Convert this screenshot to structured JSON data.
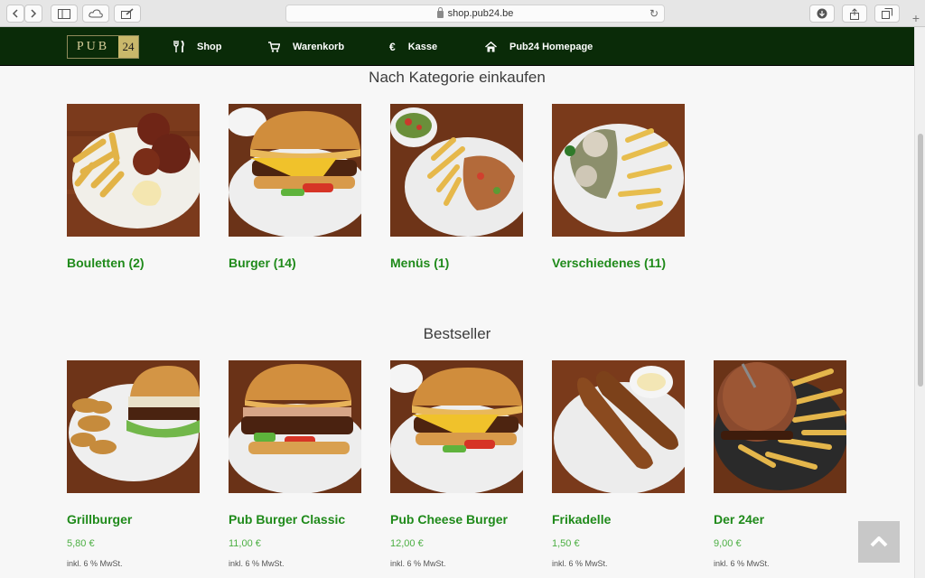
{
  "browser": {
    "url": "shop.pub24.be"
  },
  "nav": {
    "logo_word": "PUB",
    "logo_number": "24",
    "items": [
      {
        "label": "Shop",
        "icon": "cutlery-icon"
      },
      {
        "label": "Warenkorb",
        "icon": "cart-icon"
      },
      {
        "label": "Kasse",
        "icon": "euro-icon"
      },
      {
        "label": "Pub24 Homepage",
        "icon": "home-icon"
      }
    ]
  },
  "categories": {
    "title": "Nach Kategorie einkaufen",
    "items": [
      {
        "label": "Bouletten (2)"
      },
      {
        "label": "Burger (14)"
      },
      {
        "label": "Menüs (1)"
      },
      {
        "label": "Verschiedenes (11)"
      }
    ]
  },
  "bestseller": {
    "title": "Bestseller",
    "items": [
      {
        "name": "Grillburger",
        "price": "5,80 €",
        "tax": "inkl. 6 % MwSt."
      },
      {
        "name": "Pub Burger Classic",
        "price": "11,00 €",
        "tax": "inkl. 6 % MwSt."
      },
      {
        "name": "Pub Cheese Burger",
        "price": "12,00 €",
        "tax": "inkl. 6 % MwSt."
      },
      {
        "name": "Frikadelle",
        "price": "1,50 €",
        "tax": "inkl. 6 % MwSt."
      },
      {
        "name": "Der 24er",
        "price": "9,00 €",
        "tax": "inkl. 6 % MwSt."
      }
    ]
  },
  "colors": {
    "nav_bg": "#0a2b08",
    "link_green": "#1f8a1a",
    "price_green": "#4caf43"
  }
}
